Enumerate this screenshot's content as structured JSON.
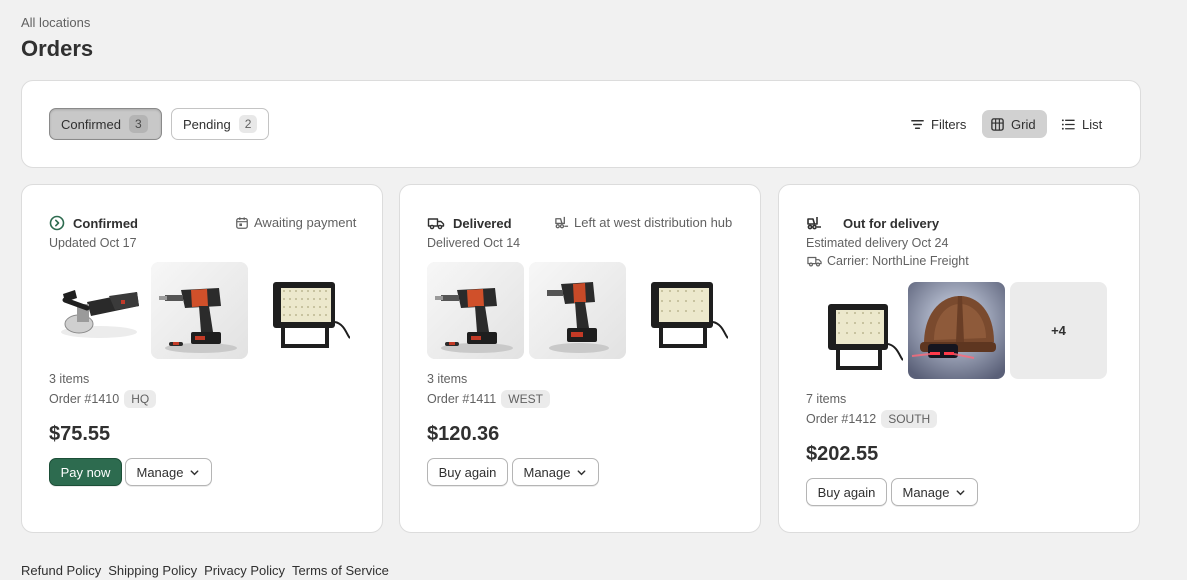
{
  "breadcrumb": "All locations",
  "page_title": "Orders",
  "tabs": [
    {
      "label": "Confirmed",
      "count": "3"
    },
    {
      "label": "Pending",
      "count": "2"
    }
  ],
  "toolbar": {
    "filters": "Filters",
    "grid": "Grid",
    "list": "List"
  },
  "orders": [
    {
      "status": "Confirmed",
      "status_icon": "check-circle-icon",
      "side_note": "Awaiting payment",
      "side_icon": "calendar-icon",
      "date": "Updated Oct 17",
      "products": [
        "angle-grinder-image",
        "drill-image",
        "floodlight-image"
      ],
      "items": "3 items",
      "order_no": "Order #1410",
      "location": "HQ",
      "price": "$75.55",
      "primary_action": "Pay now",
      "manage": "Manage"
    },
    {
      "status": "Delivered",
      "status_icon": "truck-icon",
      "side_note": "Left at west distribution hub",
      "side_icon": "forklift-icon",
      "date": "Delivered Oct 14",
      "products": [
        "drill-image",
        "drill-image",
        "floodlight-image"
      ],
      "items": "3 items",
      "order_no": "Order #1411",
      "location": "WEST",
      "price": "$120.36",
      "primary_action": "Buy again",
      "manage": "Manage"
    },
    {
      "status": "Out for delivery",
      "status_icon": "forklift-icon",
      "date": "Estimated delivery Oct 24",
      "carrier": "Carrier: NorthLine Freight",
      "carrier_icon": "truck-icon",
      "products": [
        "floodlight-image",
        "hard-hat-image"
      ],
      "more": "+4",
      "items": "7 items",
      "order_no": "Order #1412",
      "location": "SOUTH",
      "price": "$202.55",
      "primary_action": "Buy again",
      "manage": "Manage"
    }
  ],
  "footer": [
    "Refund Policy",
    "Shipping Policy",
    "Privacy Policy",
    "Terms of Service"
  ]
}
